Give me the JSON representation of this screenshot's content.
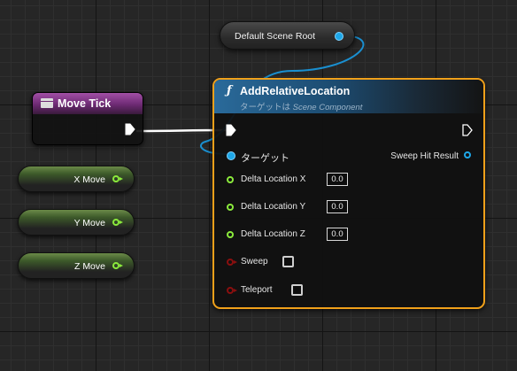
{
  "scene_root": {
    "label": "Default Scene Root"
  },
  "event_node": {
    "title": "Move Tick"
  },
  "getters": [
    {
      "label": "X Move"
    },
    {
      "label": "Y Move"
    },
    {
      "label": "Z Move"
    }
  ],
  "function_node": {
    "title": "AddRelativeLocation",
    "subtitle_prefix": "ターゲットは ",
    "subtitle_class": "Scene Component",
    "target_label": "ターゲット",
    "sweep_hit_label": "Sweep Hit Result",
    "inputs": [
      {
        "label": "Delta Location X",
        "value": "0.0"
      },
      {
        "label": "Delta Location Y",
        "value": "0.0"
      },
      {
        "label": "Delta Location Z",
        "value": "0.0"
      }
    ],
    "sweep_label": "Sweep",
    "teleport_label": "Teleport"
  },
  "colors": {
    "object_pin": "#1ea7e8",
    "float_pin": "#8bea3c",
    "bool_pin": "#8a0f0f",
    "selection_outline": "#f0a01a",
    "event_header": "#a24fa6",
    "function_header": "#2a6a9a"
  },
  "icons": {
    "event": "event-node-icon",
    "function": "function-icon",
    "exec_out": "exec-pin-icon"
  }
}
